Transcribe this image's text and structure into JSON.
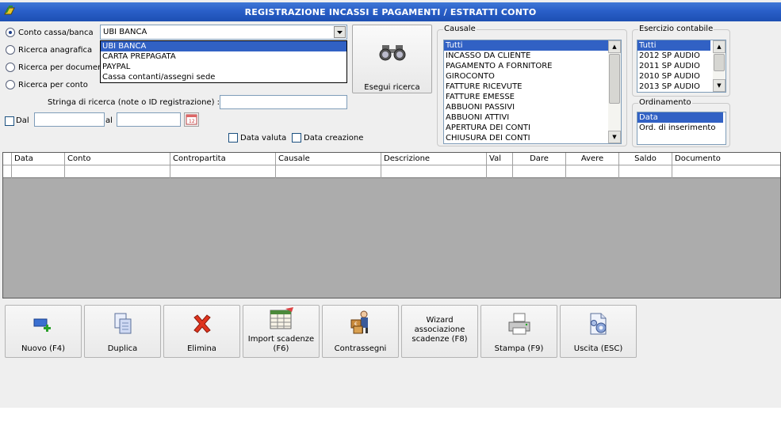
{
  "window": {
    "title": "REGISTRAZIONE INCASSI E PAGAMENTI / ESTRATTI CONTO"
  },
  "search_mode": {
    "options": [
      {
        "label": "Conto cassa/banca",
        "selected": true
      },
      {
        "label": "Ricerca anagrafica",
        "selected": false
      },
      {
        "label": "Ricerca per documento",
        "selected": false
      },
      {
        "label": "Ricerca per conto",
        "selected": false
      }
    ]
  },
  "account_combo": {
    "value": "UBI BANCA",
    "options": [
      "UBI BANCA",
      "CARTA PREPAGATA",
      "PAYPAL",
      "Cassa contanti/assegni sede"
    ]
  },
  "search_string": {
    "label": "Stringa di ricerca (note o ID registrazione) :",
    "value": ""
  },
  "date_range": {
    "from_label": "Dal",
    "to_label": "al",
    "from_value": "",
    "to_value": ""
  },
  "date_flags": {
    "valuta_label": "Data valuta",
    "creazione_label": "Data creazione"
  },
  "search_button": {
    "label": "Esegui ricerca"
  },
  "causale": {
    "caption": "Causale",
    "items": [
      "Tutti",
      "INCASSO DA CLIENTE",
      "PAGAMENTO A FORNITORE",
      "GIROCONTO",
      "FATTURE RICEVUTE",
      "FATTURE EMESSE",
      "ABBUONI PASSIVI",
      "ABBUONI ATTIVI",
      "APERTURA DEI CONTI",
      "CHIUSURA DEI CONTI"
    ],
    "selected": "Tutti"
  },
  "esercizio": {
    "caption": "Esercizio contabile",
    "items": [
      "Tutti",
      "2012 SP AUDIO",
      "2011 SP AUDIO",
      "2010 SP AUDIO",
      "2013 SP AUDIO"
    ],
    "selected": "Tutti"
  },
  "ordinamento": {
    "caption": "Ordinamento",
    "items": [
      "Data",
      "Ord. di inserimento"
    ],
    "selected": "Data"
  },
  "grid": {
    "columns": [
      "Data",
      "Conto",
      "Contropartita",
      "Causale",
      "Descrizione",
      "Val",
      "Dare",
      "Avere",
      "Saldo",
      "Documento"
    ]
  },
  "toolbar": {
    "new_label": "Nuovo (F4)",
    "duplicate_label": "Duplica",
    "delete_label": "Elimina",
    "import_label": "Import scadenze (F6)",
    "contrassegni_label": "Contrassegni",
    "wizard_label": "Wizard associazione scadenze (F8)",
    "print_label": "Stampa (F9)",
    "exit_label": "Uscita (ESC)"
  },
  "colors": {
    "title_bar": "#2a5fc8",
    "selection": "#3161c4"
  }
}
